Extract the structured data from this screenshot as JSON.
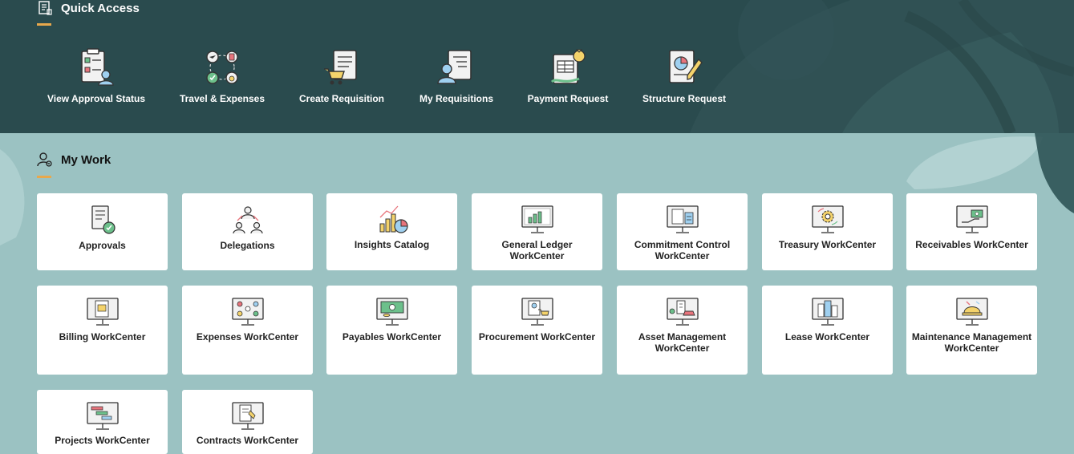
{
  "quick_access": {
    "title": "Quick Access",
    "icon": "document-icon",
    "items": [
      {
        "label": "View Approval Status",
        "icon": "approval-checklist-icon"
      },
      {
        "label": "Travel & Expenses",
        "icon": "travel-expenses-icon"
      },
      {
        "label": "Create Requisition",
        "icon": "cart-document-icon"
      },
      {
        "label": "My Requisitions",
        "icon": "person-document-icon"
      },
      {
        "label": "Payment Request",
        "icon": "money-bag-document-icon"
      },
      {
        "label": "Structure Request",
        "icon": "chart-pencil-document-icon"
      }
    ]
  },
  "my_work": {
    "title": "My Work",
    "icon": "person-gear-icon",
    "tiles": [
      {
        "label": "Approvals",
        "icon": "document-check-icon"
      },
      {
        "label": "Delegations",
        "icon": "people-delegation-icon"
      },
      {
        "label": "Insights Catalog",
        "icon": "bar-chart-pie-icon"
      },
      {
        "label": "General Ledger WorkCenter",
        "icon": "monitor-bar-chart-icon"
      },
      {
        "label": "Commitment Control WorkCenter",
        "icon": "monitor-calculator-icon"
      },
      {
        "label": "Treasury WorkCenter",
        "icon": "monitor-gear-icon"
      },
      {
        "label": "Receivables WorkCenter",
        "icon": "monitor-hand-money-icon"
      },
      {
        "label": "Billing WorkCenter",
        "icon": "monitor-invoice-icon"
      },
      {
        "label": "Expenses WorkCenter",
        "icon": "monitor-flow-icon"
      },
      {
        "label": "Payables WorkCenter",
        "icon": "monitor-cash-icon"
      },
      {
        "label": "Procurement WorkCenter",
        "icon": "monitor-cart-icon"
      },
      {
        "label": "Asset Management WorkCenter",
        "icon": "monitor-building-car-icon"
      },
      {
        "label": "Lease WorkCenter",
        "icon": "monitor-buildings-icon"
      },
      {
        "label": "Maintenance Management WorkCenter",
        "icon": "monitor-hardhat-icon"
      },
      {
        "label": "Projects WorkCenter",
        "icon": "monitor-gantt-icon"
      },
      {
        "label": "Contracts WorkCenter",
        "icon": "monitor-signing-icon"
      }
    ]
  },
  "colors": {
    "header_bg": "#2a4b4e",
    "body_bg": "#9bc2c2",
    "accent": "#e8a84c",
    "tile_bg": "#ffffff"
  }
}
